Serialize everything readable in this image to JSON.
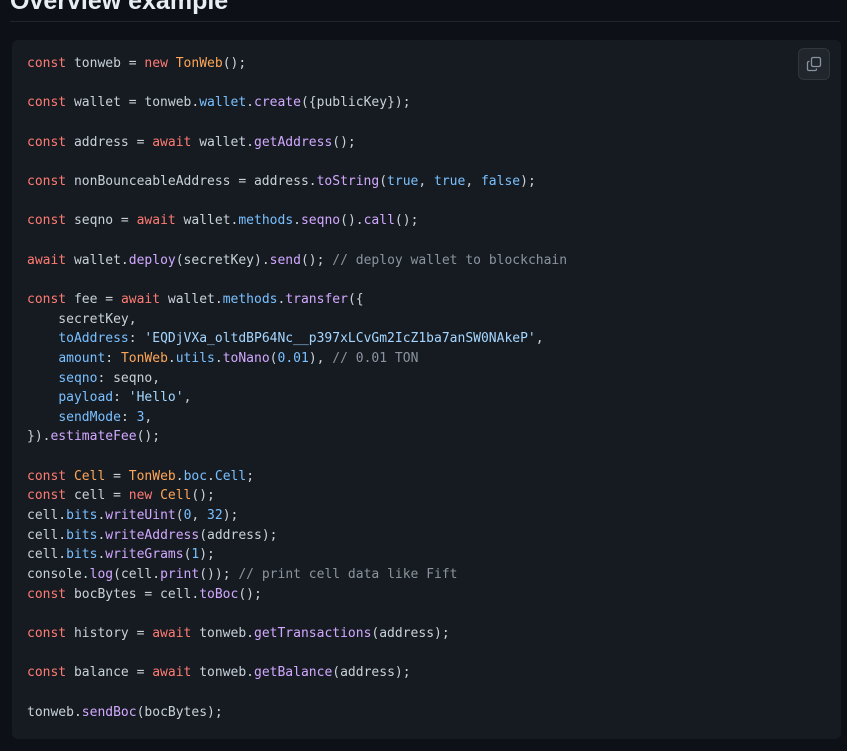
{
  "page": {
    "heading": "Overview example"
  },
  "copy_button": {
    "icon": "copy-icon"
  },
  "code_lines": [
    [
      [
        "k",
        "const"
      ],
      [
        "t",
        " tonweb = "
      ],
      [
        "k",
        "new"
      ],
      [
        "t",
        " "
      ],
      [
        "c",
        "TonWeb"
      ],
      [
        "t",
        "();"
      ]
    ],
    [],
    [
      [
        "k",
        "const"
      ],
      [
        "t",
        " wallet = tonweb."
      ],
      [
        "p",
        "wallet"
      ],
      [
        "t",
        "."
      ],
      [
        "f",
        "create"
      ],
      [
        "t",
        "({publicKey});"
      ]
    ],
    [],
    [
      [
        "k",
        "const"
      ],
      [
        "t",
        " address = "
      ],
      [
        "k",
        "await"
      ],
      [
        "t",
        " wallet."
      ],
      [
        "f",
        "getAddress"
      ],
      [
        "t",
        "();"
      ]
    ],
    [],
    [
      [
        "k",
        "const"
      ],
      [
        "t",
        " nonBounceableAddress = address."
      ],
      [
        "f",
        "toString"
      ],
      [
        "t",
        "("
      ],
      [
        "p",
        "true"
      ],
      [
        "t",
        ", "
      ],
      [
        "p",
        "true"
      ],
      [
        "t",
        ", "
      ],
      [
        "p",
        "false"
      ],
      [
        "t",
        ");"
      ]
    ],
    [],
    [
      [
        "k",
        "const"
      ],
      [
        "t",
        " seqno = "
      ],
      [
        "k",
        "await"
      ],
      [
        "t",
        " wallet."
      ],
      [
        "p",
        "methods"
      ],
      [
        "t",
        "."
      ],
      [
        "f",
        "seqno"
      ],
      [
        "t",
        "()."
      ],
      [
        "f",
        "call"
      ],
      [
        "t",
        "();"
      ]
    ],
    [],
    [
      [
        "k",
        "await"
      ],
      [
        "t",
        " wallet."
      ],
      [
        "f",
        "deploy"
      ],
      [
        "t",
        "(secretKey)."
      ],
      [
        "f",
        "send"
      ],
      [
        "t",
        "(); "
      ],
      [
        "m",
        "// deploy wallet to blockchain"
      ]
    ],
    [],
    [
      [
        "k",
        "const"
      ],
      [
        "t",
        " fee = "
      ],
      [
        "k",
        "await"
      ],
      [
        "t",
        " wallet."
      ],
      [
        "p",
        "methods"
      ],
      [
        "t",
        "."
      ],
      [
        "f",
        "transfer"
      ],
      [
        "t",
        "({"
      ]
    ],
    [
      [
        "t",
        "    secretKey,"
      ]
    ],
    [
      [
        "t",
        "    "
      ],
      [
        "p",
        "toAddress"
      ],
      [
        "t",
        ": "
      ],
      [
        "s",
        "'EQDjVXa_oltdBP64Nc__p397xLCvGm2IcZ1ba7anSW0NAkeP'"
      ],
      [
        "t",
        ","
      ]
    ],
    [
      [
        "t",
        "    "
      ],
      [
        "p",
        "amount"
      ],
      [
        "t",
        ": "
      ],
      [
        "c",
        "TonWeb"
      ],
      [
        "t",
        "."
      ],
      [
        "p",
        "utils"
      ],
      [
        "t",
        "."
      ],
      [
        "f",
        "toNano"
      ],
      [
        "t",
        "("
      ],
      [
        "p",
        "0.01"
      ],
      [
        "t",
        "), "
      ],
      [
        "m",
        "// 0.01 TON"
      ]
    ],
    [
      [
        "t",
        "    "
      ],
      [
        "p",
        "seqno"
      ],
      [
        "t",
        ": seqno,"
      ]
    ],
    [
      [
        "t",
        "    "
      ],
      [
        "p",
        "payload"
      ],
      [
        "t",
        ": "
      ],
      [
        "s",
        "'Hello'"
      ],
      [
        "t",
        ","
      ]
    ],
    [
      [
        "t",
        "    "
      ],
      [
        "p",
        "sendMode"
      ],
      [
        "t",
        ": "
      ],
      [
        "p",
        "3"
      ],
      [
        "t",
        ","
      ]
    ],
    [
      [
        "t",
        "})."
      ],
      [
        "f",
        "estimateFee"
      ],
      [
        "t",
        "();"
      ]
    ],
    [],
    [
      [
        "k",
        "const"
      ],
      [
        "t",
        " "
      ],
      [
        "c",
        "Cell"
      ],
      [
        "t",
        " = "
      ],
      [
        "c",
        "TonWeb"
      ],
      [
        "t",
        "."
      ],
      [
        "p",
        "boc"
      ],
      [
        "t",
        "."
      ],
      [
        "p",
        "Cell"
      ],
      [
        "t",
        ";"
      ]
    ],
    [
      [
        "k",
        "const"
      ],
      [
        "t",
        " cell = "
      ],
      [
        "k",
        "new"
      ],
      [
        "t",
        " "
      ],
      [
        "c",
        "Cell"
      ],
      [
        "t",
        "();"
      ]
    ],
    [
      [
        "t",
        "cell."
      ],
      [
        "p",
        "bits"
      ],
      [
        "t",
        "."
      ],
      [
        "f",
        "writeUint"
      ],
      [
        "t",
        "("
      ],
      [
        "p",
        "0"
      ],
      [
        "t",
        ", "
      ],
      [
        "p",
        "32"
      ],
      [
        "t",
        ");"
      ]
    ],
    [
      [
        "t",
        "cell."
      ],
      [
        "p",
        "bits"
      ],
      [
        "t",
        "."
      ],
      [
        "f",
        "writeAddress"
      ],
      [
        "t",
        "(address);"
      ]
    ],
    [
      [
        "t",
        "cell."
      ],
      [
        "p",
        "bits"
      ],
      [
        "t",
        "."
      ],
      [
        "f",
        "writeGrams"
      ],
      [
        "t",
        "("
      ],
      [
        "p",
        "1"
      ],
      [
        "t",
        ");"
      ]
    ],
    [
      [
        "t",
        "console."
      ],
      [
        "f",
        "log"
      ],
      [
        "t",
        "(cell."
      ],
      [
        "f",
        "print"
      ],
      [
        "t",
        "()); "
      ],
      [
        "m",
        "// print cell data like Fift"
      ]
    ],
    [
      [
        "k",
        "const"
      ],
      [
        "t",
        " bocBytes = cell."
      ],
      [
        "f",
        "toBoc"
      ],
      [
        "t",
        "();"
      ]
    ],
    [],
    [
      [
        "k",
        "const"
      ],
      [
        "t",
        " history = "
      ],
      [
        "k",
        "await"
      ],
      [
        "t",
        " tonweb."
      ],
      [
        "f",
        "getTransactions"
      ],
      [
        "t",
        "(address);"
      ]
    ],
    [],
    [
      [
        "k",
        "const"
      ],
      [
        "t",
        " balance = "
      ],
      [
        "k",
        "await"
      ],
      [
        "t",
        " tonweb."
      ],
      [
        "f",
        "getBalance"
      ],
      [
        "t",
        "(address);"
      ]
    ],
    [],
    [
      [
        "t",
        "tonweb."
      ],
      [
        "f",
        "sendBoc"
      ],
      [
        "t",
        "(bocBytes);"
      ]
    ]
  ]
}
